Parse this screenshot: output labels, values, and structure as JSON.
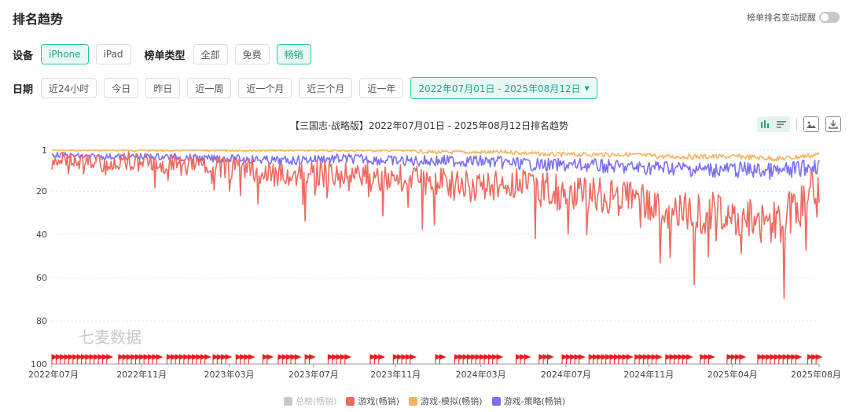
{
  "header": {
    "title": "排名趋势",
    "toggle_label": "榜单排名变动提醒"
  },
  "filters": {
    "device_label": "设备",
    "devices": [
      {
        "label": "iPhone",
        "active": true
      },
      {
        "label": "iPad",
        "active": false
      }
    ],
    "type_label": "榜单类型",
    "types": [
      {
        "label": "全部",
        "active": false
      },
      {
        "label": "免费",
        "active": false
      },
      {
        "label": "畅销",
        "active": true
      }
    ],
    "date_label": "日期",
    "ranges": [
      "近24小时",
      "今日",
      "昨日",
      "近一周",
      "近一个月",
      "近三个月",
      "近一年"
    ],
    "date_range": "2022年07月01日 - 2025年08月12日",
    "dropdown_arrow": "▼"
  },
  "chart": {
    "title": "【三国志·战略版】2022年07月01日 - 2025年08月12日排名趋势",
    "watermark": "七麦数据",
    "legend": [
      {
        "label": "总榜(畅销)",
        "color": "#c8c8c8",
        "muted": true
      },
      {
        "label": "游戏(畅销)",
        "color": "#ee6a60",
        "muted": false
      },
      {
        "label": "游戏-模拟(畅销)",
        "color": "#f8b15e",
        "muted": false
      },
      {
        "label": "游戏-策略(畅销)",
        "color": "#7b6ff2",
        "muted": false
      }
    ]
  },
  "chart_data": {
    "type": "line",
    "y_reversed": true,
    "ylim": [
      1,
      100
    ],
    "y_ticks": [
      "1",
      "20",
      "40",
      "60",
      "80",
      "100"
    ],
    "y_tick_values": [
      1,
      20,
      40,
      60,
      80,
      100
    ],
    "x_ticks": [
      "2022年07月",
      "2022年11月",
      "2023年03月",
      "2023年07月",
      "2023年11月",
      "2024年03月",
      "2024年07月",
      "2024年11月",
      "2025年04月",
      "2025年08月"
    ],
    "x_tick_fractions": [
      0.0,
      0.117,
      0.231,
      0.341,
      0.448,
      0.559,
      0.67,
      0.778,
      0.887,
      1.0
    ],
    "series": [
      {
        "name": "游戏-模拟(畅销)",
        "color": "#f8b15e",
        "x": [
          0,
          0.05,
          0.1,
          0.15,
          0.2,
          0.25,
          0.3,
          0.35,
          0.4,
          0.45,
          0.5,
          0.55,
          0.6,
          0.65,
          0.7,
          0.75,
          0.8,
          0.85,
          0.9,
          0.95,
          1.0
        ],
        "y": [
          1,
          1,
          1,
          1,
          1,
          1,
          1,
          1,
          1,
          1,
          2,
          2,
          2,
          3,
          3,
          3,
          4,
          4,
          4,
          5,
          3
        ]
      },
      {
        "name": "游戏-策略(畅销)",
        "color": "#7b6ff2",
        "x": [
          0,
          0.05,
          0.1,
          0.15,
          0.2,
          0.25,
          0.3,
          0.35,
          0.4,
          0.45,
          0.5,
          0.55,
          0.6,
          0.65,
          0.7,
          0.75,
          0.8,
          0.85,
          0.9,
          0.95,
          1.0
        ],
        "y": [
          3,
          4,
          4,
          4,
          5,
          5,
          6,
          5,
          5,
          6,
          6,
          6,
          7,
          8,
          8,
          9,
          9,
          10,
          10,
          11,
          8
        ]
      },
      {
        "name": "游戏(畅销)",
        "color": "#ee6a60",
        "x": [
          0,
          0.05,
          0.1,
          0.15,
          0.2,
          0.25,
          0.3,
          0.35,
          0.4,
          0.45,
          0.5,
          0.55,
          0.6,
          0.65,
          0.7,
          0.75,
          0.8,
          0.85,
          0.9,
          0.95,
          1.0
        ],
        "y": [
          5,
          7,
          6,
          8,
          8,
          10,
          12,
          12,
          13,
          14,
          15,
          18,
          16,
          20,
          22,
          24,
          28,
          30,
          32,
          35,
          17
        ]
      }
    ],
    "totals_at_bottom": true
  }
}
